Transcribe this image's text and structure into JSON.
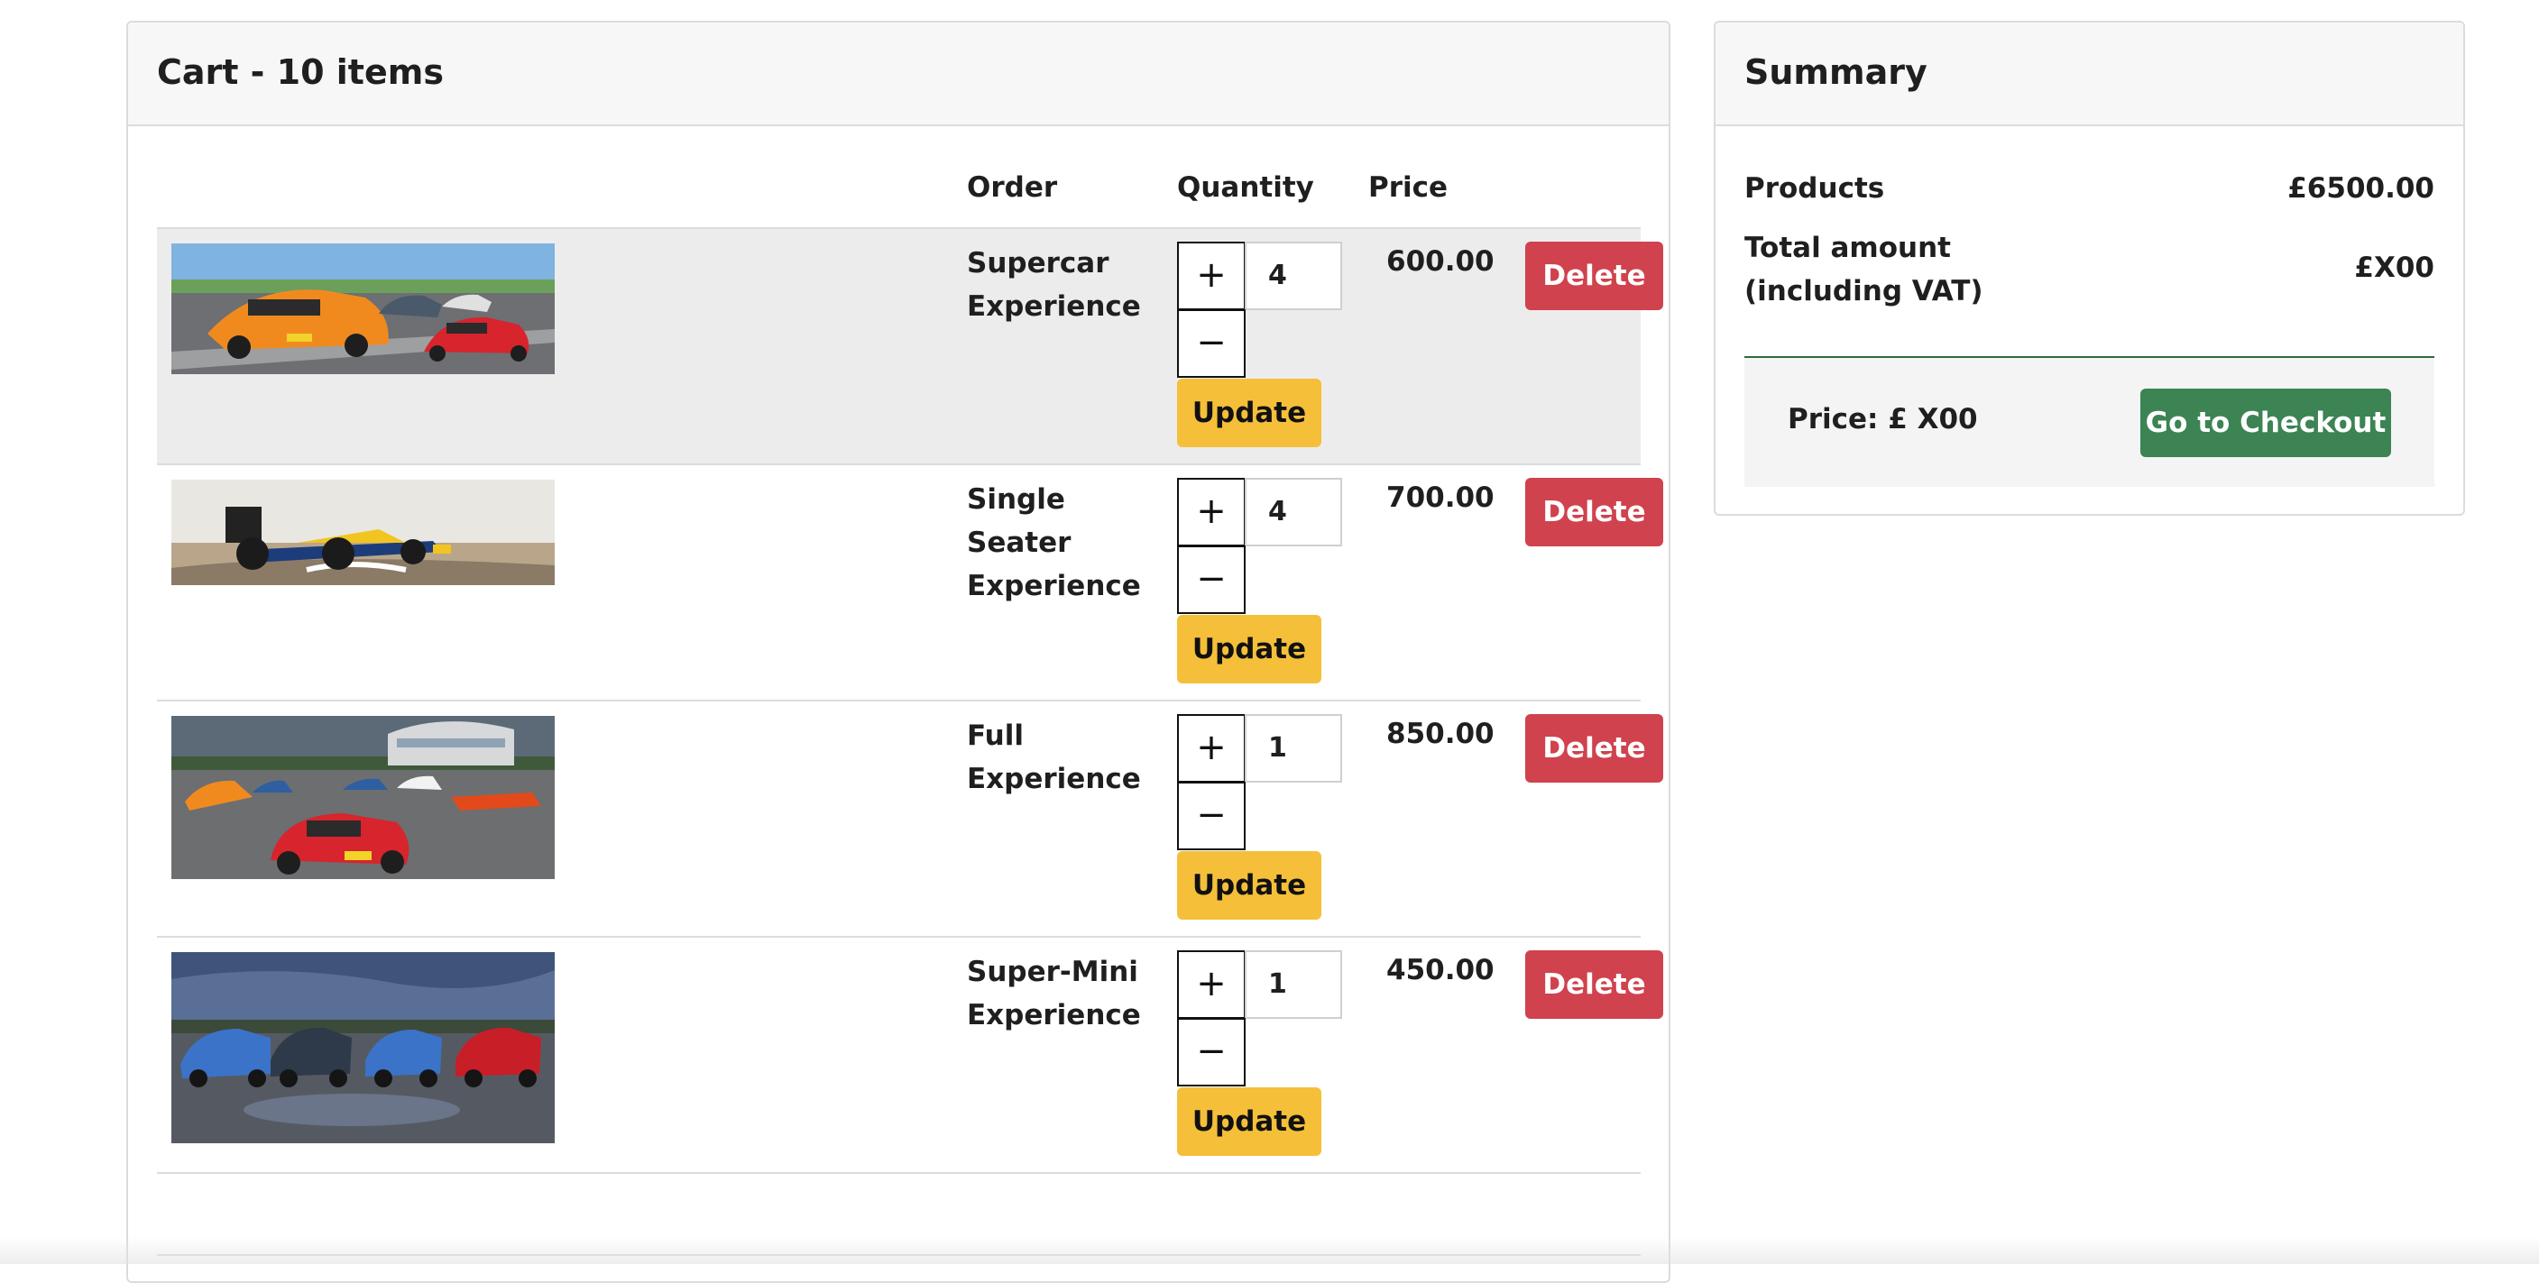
{
  "cart": {
    "title": "Cart - 10 items",
    "columns": {
      "order": "Order",
      "quantity": "Quantity",
      "price": "Price"
    },
    "items": [
      {
        "name": "Supercar Experience",
        "quantity": "4",
        "price": "600.00",
        "image": "supercar-photo"
      },
      {
        "name": "Single Seater Experience",
        "quantity": "4",
        "price": "700.00",
        "image": "single-seater-photo"
      },
      {
        "name": "Full Experience",
        "quantity": "1",
        "price": "850.00",
        "image": "full-experience-photo"
      },
      {
        "name": "Super-Mini Experience",
        "quantity": "1",
        "price": "450.00",
        "image": "super-mini-photo"
      }
    ],
    "buttons": {
      "plus": "+",
      "minus": "−",
      "update": "Update",
      "delete": "Delete"
    }
  },
  "summary": {
    "title": "Summary",
    "products_label": "Products",
    "products_value": "£6500.00",
    "total_label": "Total amount (including VAT)",
    "total_value": "£X00",
    "checkout_price": "Price: £ X00",
    "checkout_button": "Go to Checkout"
  },
  "colors": {
    "update": "#f5bf3a",
    "delete": "#d0424d",
    "checkout": "#3c8453",
    "header_bg": "#f7f7f7"
  }
}
